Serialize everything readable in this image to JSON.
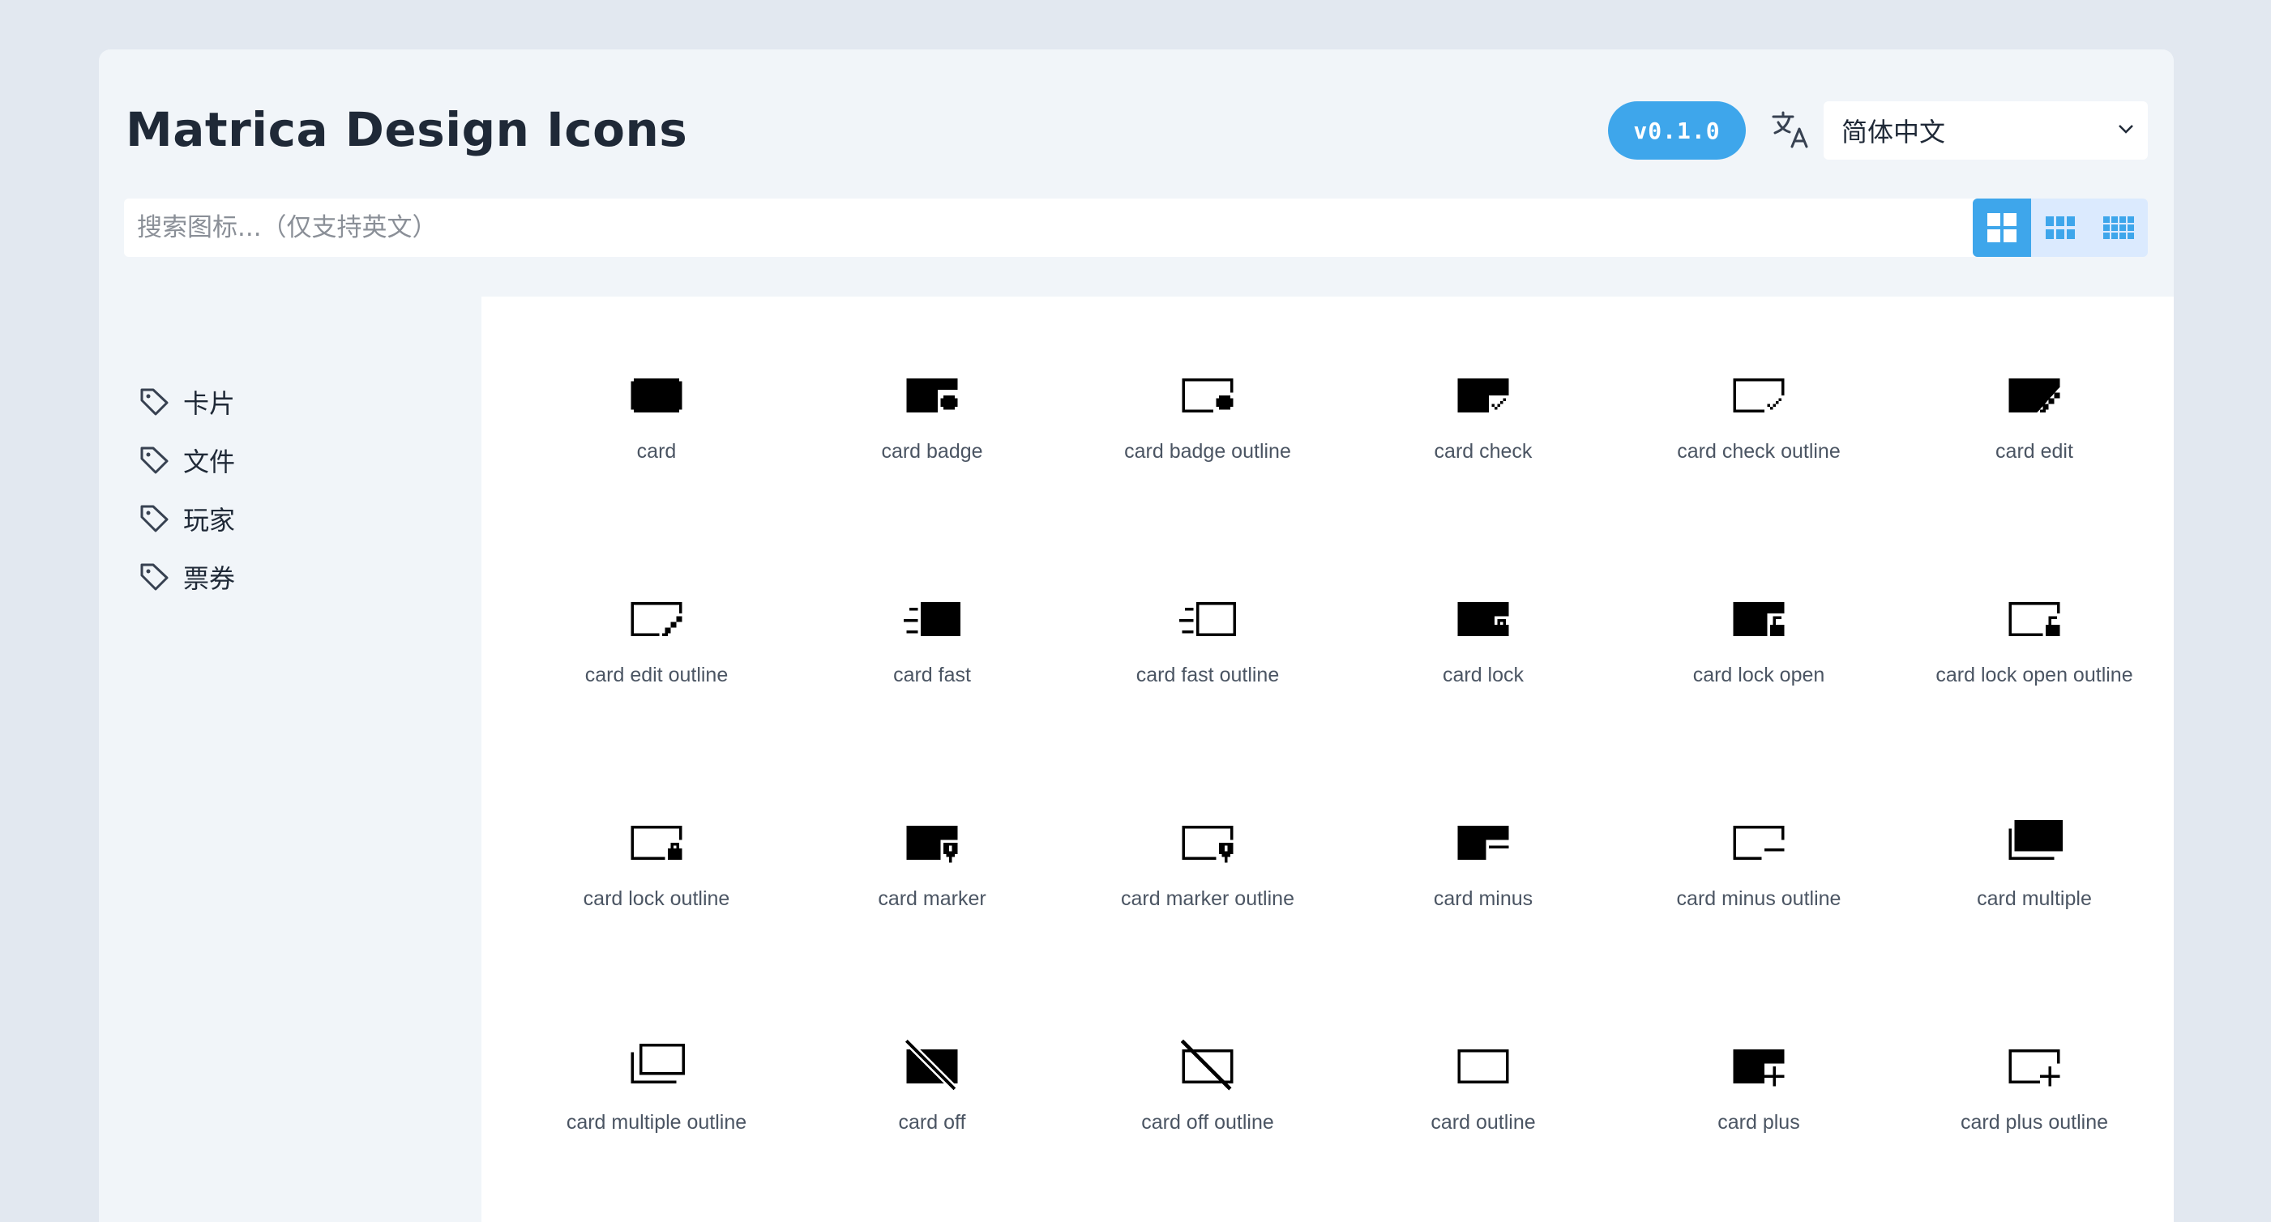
{
  "header": {
    "title": "Matrica Design Icons",
    "version": "v0.1.0",
    "language": {
      "selected": "简体中文"
    },
    "search": {
      "placeholder": "搜索图标...（仅支持英文）"
    }
  },
  "colors": {
    "accent": "#3ea6eb",
    "background": "#e2e8f0",
    "panel": "#f1f5f9"
  },
  "view_modes": [
    "large-grid",
    "medium-grid",
    "small-grid"
  ],
  "active_view": "large-grid",
  "sidebar": {
    "categories": [
      {
        "label": "卡片",
        "icon": "tag-icon"
      },
      {
        "label": "文件",
        "icon": "tag-icon"
      },
      {
        "label": "玩家",
        "icon": "tag-icon"
      },
      {
        "label": "票券",
        "icon": "tag-icon"
      }
    ]
  },
  "icons": [
    "card",
    "card badge",
    "card badge outline",
    "card check",
    "card check outline",
    "card edit",
    "card edit outline",
    "card fast",
    "card fast outline",
    "card lock",
    "card lock open",
    "card lock open outline",
    "card lock outline",
    "card marker",
    "card marker outline",
    "card minus",
    "card minus outline",
    "card multiple",
    "card multiple outline",
    "card off",
    "card off outline",
    "card outline",
    "card plus",
    "card plus outline"
  ]
}
